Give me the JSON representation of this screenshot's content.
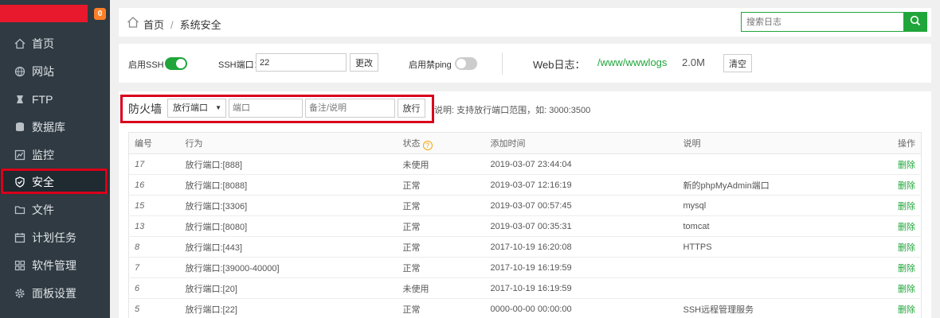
{
  "sidebar": {
    "badge": "0",
    "items": [
      {
        "label": "首页",
        "icon": "home-icon"
      },
      {
        "label": "网站",
        "icon": "globe-icon"
      },
      {
        "label": "FTP",
        "icon": "ftp-icon"
      },
      {
        "label": "数据库",
        "icon": "database-icon"
      },
      {
        "label": "监控",
        "icon": "monitor-icon"
      },
      {
        "label": "安全",
        "icon": "shield-icon"
      },
      {
        "label": "文件",
        "icon": "folder-icon"
      },
      {
        "label": "计划任务",
        "icon": "calendar-icon"
      },
      {
        "label": "软件管理",
        "icon": "grid-icon"
      },
      {
        "label": "面板设置",
        "icon": "gear-icon"
      }
    ]
  },
  "breadcrumb": {
    "home": "首页",
    "sep": "/",
    "current": "系统安全"
  },
  "search": {
    "placeholder": "搜索日志"
  },
  "settings": {
    "ssh_label": "启用SSH",
    "ssh_port_label": "SSH端口：",
    "ssh_port_value": "22",
    "change_btn": "更改",
    "ping_label": "启用禁ping",
    "weblog_label": "Web日志：",
    "weblog_path": "/www/wwwlogs",
    "weblog_size": "2.0M",
    "clear_btn": "清空"
  },
  "firewall": {
    "title": "防火墙",
    "select_value": "放行端口",
    "port_placeholder": "端口",
    "remark_placeholder": "备注/说明",
    "allow_btn": "放行",
    "note": "说明: 支持放行端口范围，如: 3000:3500"
  },
  "table": {
    "headers": {
      "id": "编号",
      "action": "行为",
      "status": "状态",
      "time": "添加时间",
      "desc": "说明",
      "op": "操作"
    },
    "rows": [
      {
        "id": "17",
        "action": "放行端口:[888]",
        "status": "未使用",
        "time": "2019-03-07 23:44:04",
        "desc": "",
        "op": "删除"
      },
      {
        "id": "16",
        "action": "放行端口:[8088]",
        "status": "正常",
        "time": "2019-03-07 12:16:19",
        "desc": "新的phpMyAdmin端口",
        "op": "删除"
      },
      {
        "id": "15",
        "action": "放行端口:[3306]",
        "status": "正常",
        "time": "2019-03-07 00:57:45",
        "desc": "mysql",
        "op": "删除"
      },
      {
        "id": "13",
        "action": "放行端口:[8080]",
        "status": "正常",
        "time": "2019-03-07 00:35:31",
        "desc": "tomcat",
        "op": "删除"
      },
      {
        "id": "8",
        "action": "放行端口:[443]",
        "status": "正常",
        "time": "2017-10-19 16:20:08",
        "desc": "HTTPS",
        "op": "删除"
      },
      {
        "id": "7",
        "action": "放行端口:[39000-40000]",
        "status": "正常",
        "time": "2017-10-19 16:19:59",
        "desc": "",
        "op": "删除"
      },
      {
        "id": "6",
        "action": "放行端口:[20]",
        "status": "未使用",
        "time": "2017-10-19 16:19:59",
        "desc": "",
        "op": "删除"
      },
      {
        "id": "5",
        "action": "放行端口:[22]",
        "status": "正常",
        "time": "0000-00-00 00:00:00",
        "desc": "SSH远程管理服务",
        "op": "删除"
      }
    ]
  }
}
